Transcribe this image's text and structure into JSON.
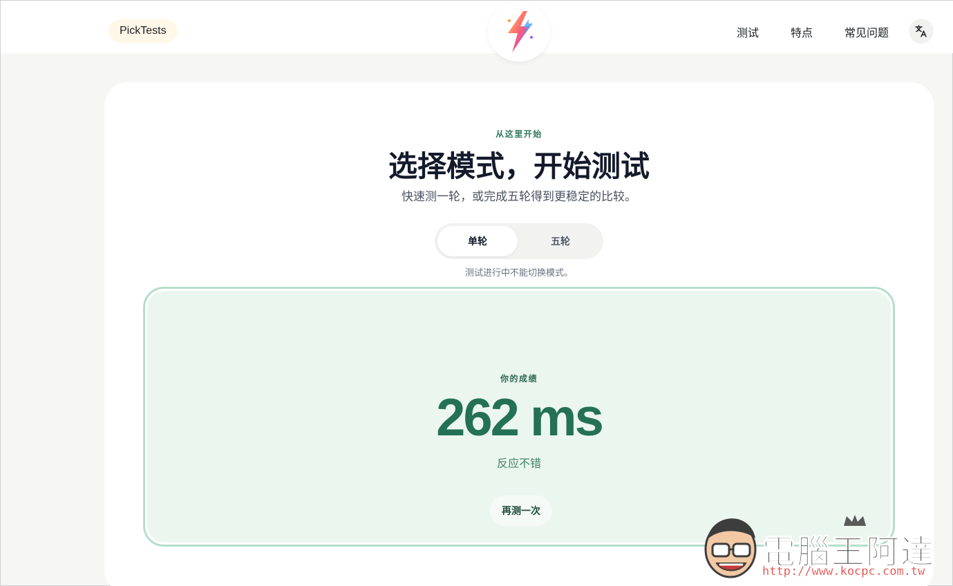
{
  "header": {
    "brand": "PickTests",
    "logo_icon": "lightning-bolt-icon",
    "nav": [
      "测试",
      "特点",
      "常见问题"
    ],
    "language_icon": "translate-icon"
  },
  "hero": {
    "eyebrow": "从这里开始",
    "title": "选择模式，开始测试",
    "subtitle": "快速测一轮，或完成五轮得到更稳定的比较。"
  },
  "mode": {
    "options": [
      "单轮",
      "五轮"
    ],
    "selected": "单轮",
    "note": "测试进行中不能切换模式。"
  },
  "result": {
    "label": "你的成绩",
    "score": "262 ms",
    "verdict": "反应不错",
    "retry_label": "再测一次"
  },
  "watermark": {
    "title": "電腦王阿達",
    "url": "http://www.kocpc.com.tw"
  },
  "colors": {
    "accent_green": "#247155",
    "result_bg": "#ebf6ef",
    "result_border": "#b4dfca",
    "headline": "#141a2b"
  }
}
